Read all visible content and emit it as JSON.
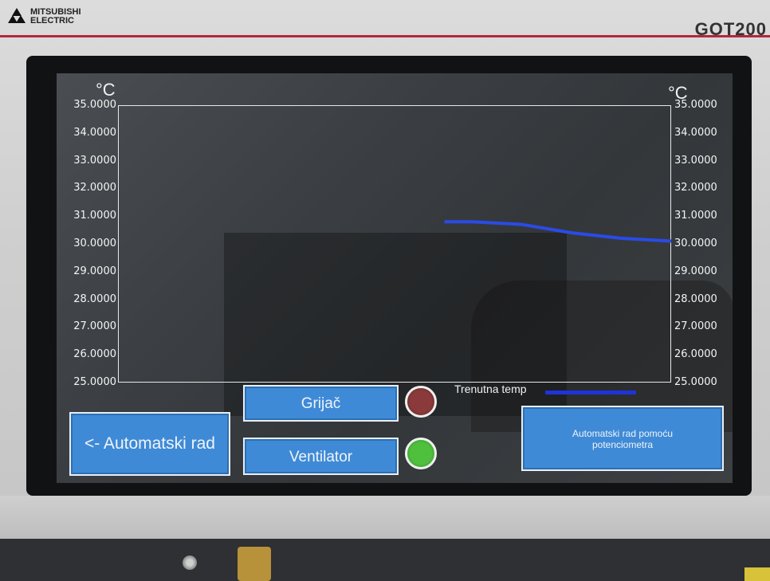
{
  "brand": {
    "line1": "MITSUBISHI",
    "line2": "ELECTRIC",
    "model": "GOT200"
  },
  "chart_data": {
    "type": "line",
    "left_unit": "°C",
    "right_unit": "°C",
    "ylim": [
      25,
      35
    ],
    "y_ticks": [
      "35.0000",
      "34.0000",
      "33.0000",
      "32.0000",
      "31.0000",
      "30.0000",
      "29.0000",
      "28.0000",
      "27.0000",
      "26.0000",
      "25.0000"
    ],
    "grid": false,
    "series": [
      {
        "name": "Trenutna temp",
        "color": "#2a4be6",
        "points": [
          [
            0.59,
            30.8
          ],
          [
            0.64,
            30.8
          ],
          [
            0.73,
            30.7
          ],
          [
            0.82,
            30.4
          ],
          [
            0.91,
            30.2
          ],
          [
            1.0,
            30.1
          ]
        ]
      }
    ]
  },
  "legend": {
    "label": "Trenutna temp",
    "color": "#1f33d8"
  },
  "buttons": {
    "back": "<- Automatski rad",
    "heater": "Grijač",
    "fan": "Ventilator",
    "pot_line1": "Automatski rad pomoću",
    "pot_line2": "potenciometra"
  },
  "lamps": {
    "heater_color": "#8a3a3a",
    "fan_color": "#4fbf3e"
  }
}
